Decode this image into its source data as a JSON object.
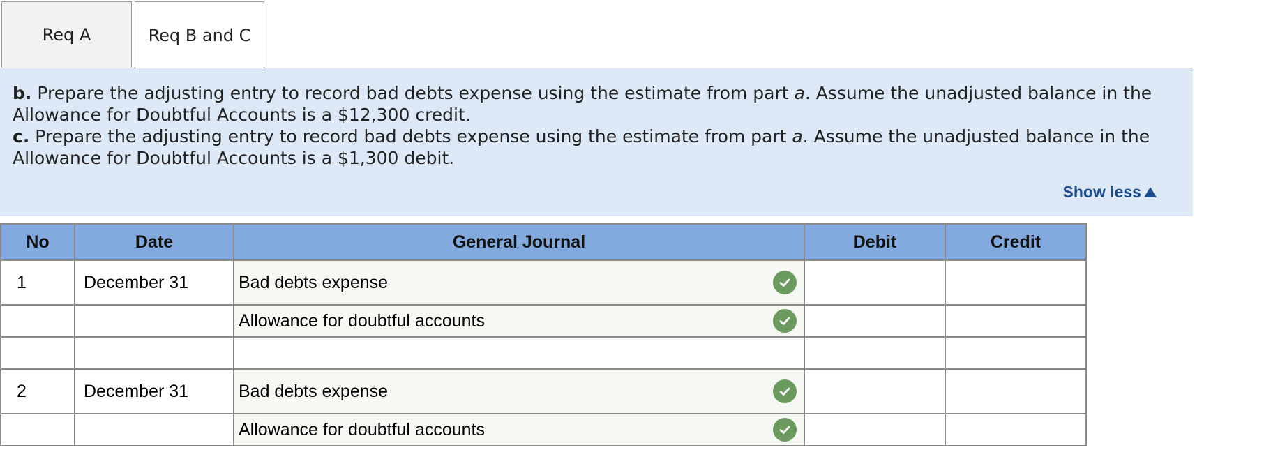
{
  "tabs": [
    {
      "label": "Req A",
      "active": false
    },
    {
      "label": "Req B and C",
      "active": true
    }
  ],
  "instructions": {
    "b": {
      "label": "b.",
      "text_before": "Prepare the adjusting entry to record bad debts expense using the estimate from part",
      "part": "a",
      "text_after": ". Assume the unadjusted balance in the Allowance for Doubtful Accounts is a $12,300 credit."
    },
    "c": {
      "label": "c.",
      "text_before": "Prepare the adjusting entry to record bad debts expense using the estimate from part",
      "part": "a",
      "text_after": ". Assume the unadjusted balance in the Allowance for Doubtful Accounts is a $1,300 debit."
    },
    "show_less_label": "Show less"
  },
  "journal": {
    "headers": {
      "no": "No",
      "date": "Date",
      "general_journal": "General Journal",
      "debit": "Debit",
      "credit": "Credit"
    },
    "rows": [
      {
        "no": "1",
        "date": "December 31",
        "account": "Bad debts expense",
        "debit": "",
        "credit": "",
        "correct": true
      },
      {
        "no": "",
        "date": "",
        "account": "Allowance for doubtful accounts",
        "debit": "",
        "credit": "",
        "correct": true
      },
      {
        "no": "",
        "date": "",
        "account": "",
        "debit": "",
        "credit": "",
        "correct": false
      },
      {
        "no": "2",
        "date": "December 31",
        "account": "Bad debts expense",
        "debit": "",
        "credit": "",
        "correct": true
      },
      {
        "no": "",
        "date": "",
        "account": "Allowance for doubtful accounts",
        "debit": "",
        "credit": "",
        "correct": true
      }
    ]
  },
  "colors": {
    "panel_bg": "#dde9f6",
    "header_bg": "#82aade",
    "link": "#1f4e8c",
    "check_green": "#6b9a5e"
  },
  "icons": {
    "correct": "check-circle-icon",
    "show_less": "triangle-up-icon"
  }
}
